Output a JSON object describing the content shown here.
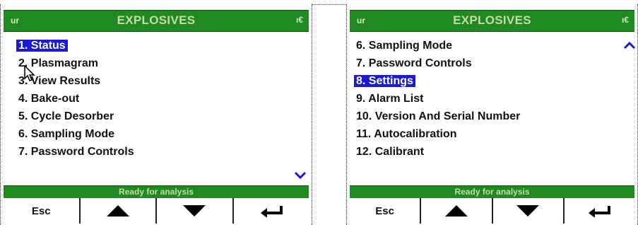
{
  "screens": [
    {
      "title": "EXPLOSIVES",
      "indicator_left": "ur",
      "indicator_right": "ı€",
      "menu": [
        {
          "label": "1.  Status",
          "selected": true
        },
        {
          "label": "2.  Plasmagram",
          "selected": false
        },
        {
          "label": "3.  View Results",
          "selected": false
        },
        {
          "label": "4.  Bake-out",
          "selected": false
        },
        {
          "label": "5.  Cycle Desorber",
          "selected": false
        },
        {
          "label": "6.  Sampling Mode",
          "selected": false
        },
        {
          "label": "7.  Password Controls",
          "selected": false
        }
      ],
      "status": "Ready for analysis",
      "softkeys": {
        "esc": "Esc"
      }
    },
    {
      "title": "EXPLOSIVES",
      "indicator_left": "ur",
      "indicator_right": "ı€",
      "menu": [
        {
          "label": "6.  Sampling Mode",
          "selected": false
        },
        {
          "label": "7.  Password Controls",
          "selected": false
        },
        {
          "label": "8.  Settings",
          "selected": true
        },
        {
          "label": "9.  Alarm List",
          "selected": false
        },
        {
          "label": "10.  Version And Serial Number",
          "selected": false
        },
        {
          "label": "11.  Autocalibration",
          "selected": false
        },
        {
          "label": "12.  Calibrant",
          "selected": false
        }
      ],
      "status": "Ready for analysis",
      "softkeys": {
        "esc": "Esc"
      }
    }
  ],
  "colors": {
    "bar_green": "#1f8a1f",
    "highlight_blue": "#1a1ad6",
    "scroll_arrow_blue": "#1a1ad6"
  },
  "icons": {
    "softkey_up": "up-triangle-icon",
    "softkey_down": "down-triangle-icon",
    "softkey_enter": "enter-arrow-icon",
    "scroll_down": "scroll-down-chevron-icon",
    "scroll_up": "scroll-up-chevron-icon",
    "cursor": "mouse-pointer-icon"
  }
}
